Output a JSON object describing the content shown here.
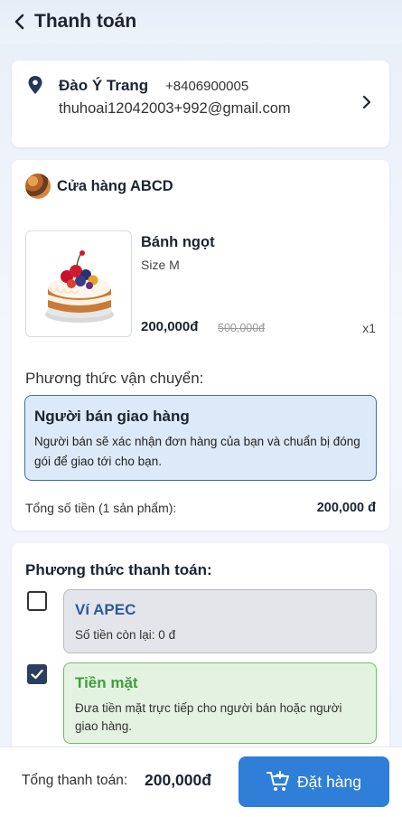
{
  "header": {
    "title": "Thanh toán"
  },
  "address": {
    "name": "Đào Ý Trang",
    "phone": "+8406900005",
    "email": "thuhoai12042003+992@gmail.com"
  },
  "shop": {
    "name": "Cửa hàng ABCD",
    "product": {
      "name": "Bánh ngọt",
      "variant": "Size M",
      "price": "200,000đ",
      "original_price": "500,000đ",
      "quantity": "x1"
    },
    "shipping": {
      "label": "Phương thức vận chuyển:",
      "option_title": "Người bán giao hàng",
      "option_desc": "Người bán sẽ xác nhận đơn hàng của bạn và chuẩn bị đóng gói để giao tới cho bạn."
    },
    "subtotal_label": "Tổng số tiền (1 sản phẩm):",
    "subtotal_value": "200,000 đ"
  },
  "payment": {
    "heading": "Phương thức thanh toán:",
    "options": [
      {
        "title": "Ví APEC",
        "desc": "Số tiền còn lại: 0 đ",
        "checked": false
      },
      {
        "title": "Tiền mặt",
        "desc": "Đưa tiền mặt trực tiếp cho người bán hoặc người giao hàng.",
        "checked": true
      }
    ]
  },
  "footer": {
    "total_label": "Tổng thanh toán:",
    "total_value": "200,000đ",
    "order_button": "Đặt hàng"
  },
  "colors": {
    "accent": "#2f7fd8",
    "ship_selected_bg": "#dbe9f8",
    "cash_selected_border": "#6fbe65",
    "wallet_title": "#2b5a9a",
    "cash_title": "#3f9d3a"
  },
  "icons": {
    "back": "chevron-left-icon",
    "location": "map-pin-icon",
    "next": "chevron-right-icon",
    "checked": "check-icon",
    "order": "cart-plus-icon"
  }
}
